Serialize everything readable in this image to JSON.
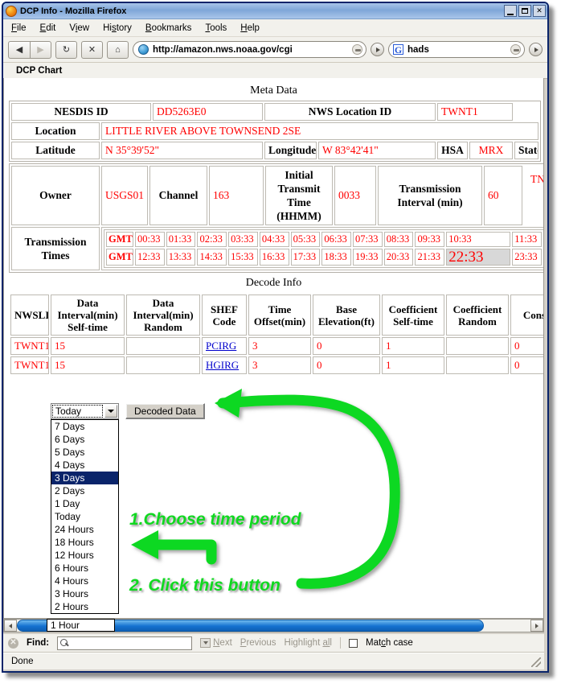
{
  "window": {
    "title": "DCP Info - Mozilla Firefox",
    "minimize_label": "_",
    "maximize_label": "□",
    "close_label": "X"
  },
  "menubar": {
    "items": [
      "File",
      "Edit",
      "View",
      "History",
      "Bookmarks",
      "Tools",
      "Help"
    ]
  },
  "toolbar": {
    "back_label": "◀",
    "forward_label": "▶",
    "reload_label": "↻",
    "stop_label": "✕",
    "home_label": "⌂",
    "url": "http://amazon.nws.noaa.gov/cgi",
    "search_value": "hads",
    "google_letter": "G"
  },
  "bookmarks": {
    "items": [
      "DCP Chart"
    ]
  },
  "meta": {
    "caption": "Meta Data",
    "nesdis_id_label": "NESDIS ID",
    "nesdis_id_value": "DD5263E0",
    "nws_location_id_label": "NWS Location ID",
    "nws_location_id_value": "TWNT1",
    "location_label": "Location",
    "location_value": "LITTLE RIVER ABOVE TOWNSEND 2SE",
    "latitude_label": "Latitude",
    "latitude_value": "N 35°39'52\"",
    "longitude_label": "Longitude",
    "longitude_value": "W 83°42'41\"",
    "hsa_label": "HSA",
    "hsa_value": "MRX",
    "state_label": "State",
    "state_value": "TN",
    "owner_label": "Owner",
    "owner_value": "USGS01",
    "channel_label": "Channel",
    "channel_value": "163",
    "initial_transmit_time_label": "Initial Transmit Time (HHMM)",
    "initial_transmit_time_value": "0033",
    "transmission_interval_label": "Transmission Interval (min)",
    "transmission_interval_value": "60",
    "transmission_times_label": "Transmission Times",
    "gmt_label": "GMT",
    "times_row1": [
      "00:33",
      "01:33",
      "02:33",
      "03:33",
      "04:33",
      "05:33",
      "06:33",
      "07:33",
      "08:33",
      "09:33",
      "10:33",
      "11:33"
    ],
    "times_row2": [
      "12:33",
      "13:33",
      "14:33",
      "15:33",
      "16:33",
      "17:33",
      "18:33",
      "19:33",
      "20:33",
      "21:33",
      "22:33",
      "23:33"
    ],
    "highlighted_time": "22:33"
  },
  "decode": {
    "caption": "Decode Info",
    "headers": [
      "NWSLI",
      "Data Interval(min) Self-time",
      "Data Interval(min) Random",
      "SHEF Code",
      "Time Offset(min)",
      "Base Elevation(ft)",
      "Coefficient Self-time",
      "Coefficient Random",
      "Cons"
    ],
    "rows": [
      {
        "nwsli": "TWNT1",
        "self_time": "15",
        "random": "",
        "shef": "PCIRG",
        "offset": "3",
        "base_elev": "0",
        "coef_self": "1",
        "coef_random": "",
        "cons": "0"
      },
      {
        "nwsli": "TWNT1",
        "self_time": "15",
        "random": "",
        "shef": "HGIRG",
        "offset": "3",
        "base_elev": "0",
        "coef_self": "1",
        "coef_random": "",
        "cons": "0"
      }
    ]
  },
  "controls": {
    "period_selected": "Today",
    "period_options": [
      "7 Days",
      "6 Days",
      "5 Days",
      "4 Days",
      "3 Days",
      "2 Days",
      "1 Day",
      "Today",
      "24 Hours",
      "18 Hours",
      "12 Hours",
      "6 Hours",
      "4 Hours",
      "3 Hours",
      "2 Hours",
      "1 Hour"
    ],
    "period_highlighted": "3 Days",
    "decoded_data_button": "Decoded Data",
    "tooltip_last_option": "1 Hour"
  },
  "annotations": {
    "step1": "1.Choose time period",
    "step2": "2. Click this button",
    "color": "#10d820"
  },
  "findbar": {
    "close_label": "✕",
    "label": "Find:",
    "input_value": "",
    "next_label": "Next",
    "previous_label": "Previous",
    "highlight_all_label": "Highlight all",
    "match_case_label": "Match case"
  },
  "statusbar": {
    "text": "Done"
  },
  "colors": {
    "data_red": "#ff0000",
    "link_blue": "#0000cc",
    "annotation_green": "#10d820",
    "selection_blue": "#0a246a",
    "highlight_gray": "#d8d8d8"
  }
}
